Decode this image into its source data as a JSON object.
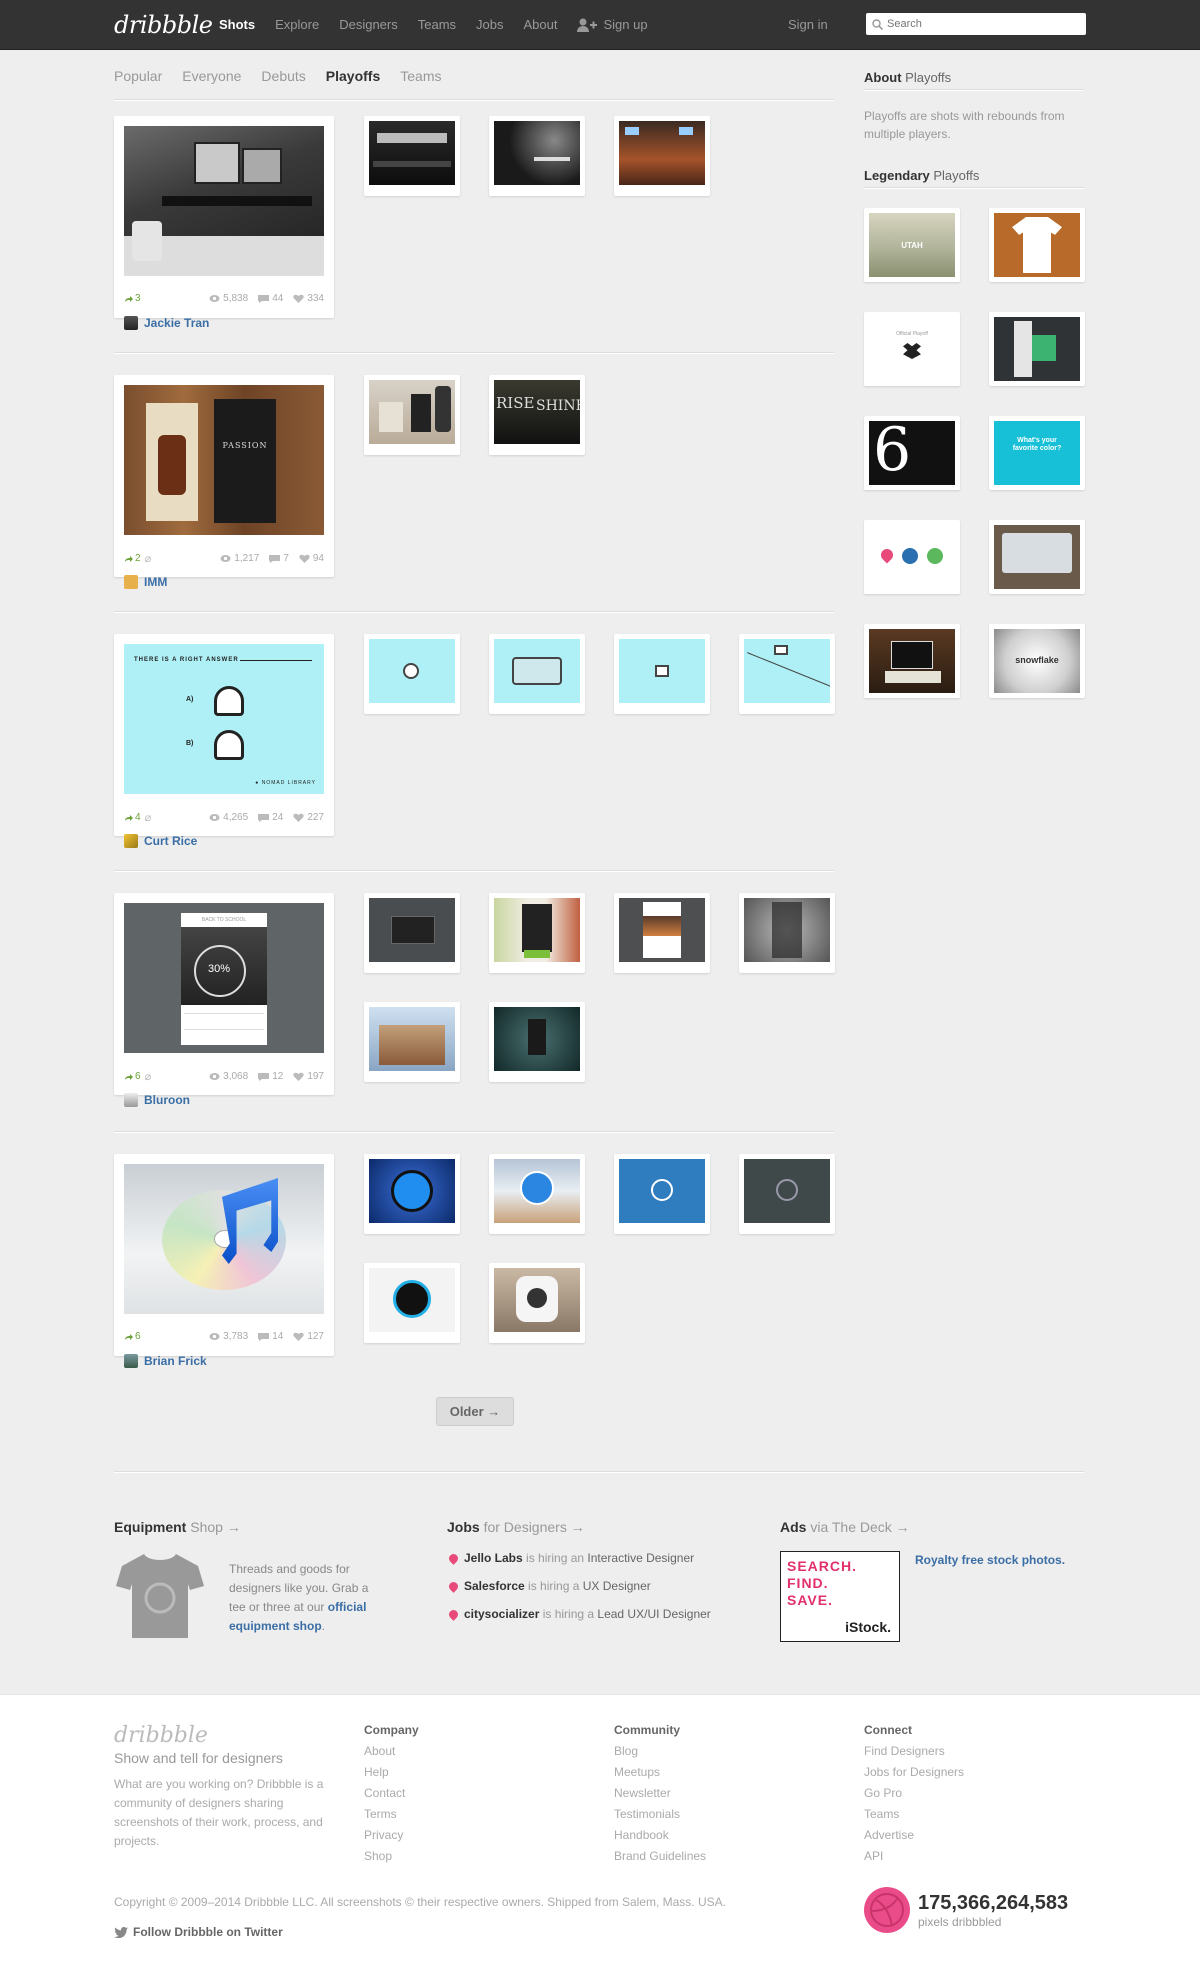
{
  "topbar": {
    "logo": "dribbble",
    "nav": [
      "Shots",
      "Explore",
      "Designers",
      "Teams",
      "Jobs",
      "About"
    ],
    "signup": "Sign up",
    "signin": "Sign in",
    "search_placeholder": "Search"
  },
  "subnav": [
    "Popular",
    "Everyone",
    "Debuts",
    "Playoffs",
    "Teams"
  ],
  "playoffs": [
    {
      "rebounds": "3",
      "views": "5,838",
      "comments": "44",
      "likes": "334",
      "author": "Jackie Tran",
      "attachment": false
    },
    {
      "rebounds": "2",
      "views": "1,217",
      "comments": "7",
      "likes": "94",
      "author": "IMM",
      "attachment": true
    },
    {
      "rebounds": "4",
      "views": "4,265",
      "comments": "24",
      "likes": "227",
      "author": "Curt Rice",
      "attachment": true
    },
    {
      "rebounds": "6",
      "views": "3,068",
      "comments": "12",
      "likes": "197",
      "author": "Bluroon",
      "attachment": true
    },
    {
      "rebounds": "6",
      "views": "3,783",
      "comments": "14",
      "likes": "127",
      "author": "Brian Frick",
      "attachment": false
    }
  ],
  "shot_texts": {
    "right_answer": "THERE IS A RIGHT ANSWER",
    "a": "A)",
    "b": "B)",
    "brand": "● NOMAD LIBRARY",
    "percent": "30%",
    "back_to_school": "BACK TO SCHOOL",
    "rise": "RISE",
    "shine": "SHINE",
    "passion": "PASSION"
  },
  "older": "Older →",
  "sidebar": {
    "about_bold": "About",
    "about_rest": " Playoffs",
    "about_text": "Playoffs are shots with rebounds from multiple players.",
    "legendary_bold": "Legendary",
    "legendary_rest": " Playoffs",
    "utah": "UTAH",
    "official_playoff": "Official Playoff",
    "six": "6",
    "fav_color": "What's your favorite color?",
    "snowflake": "snowflake"
  },
  "bottom": {
    "equipment_bold": "Equipment",
    "equipment_rest": " Shop →",
    "equipment_text_1": "Threads and goods for designers like you. Grab a tee or three at our ",
    "equipment_link": "official equipment shop",
    "equipment_text_2": ".",
    "jobs_bold": "Jobs",
    "jobs_rest": " for Designers →",
    "jobs": [
      {
        "company": "Jello Labs",
        "mid": " is hiring an ",
        "role": "Interactive Designer"
      },
      {
        "company": "Salesforce",
        "mid": " is hiring a ",
        "role": "UX Designer"
      },
      {
        "company": "citysocializer",
        "mid": " is hiring a ",
        "role": "Lead UX/UI Designer"
      }
    ],
    "ads_bold": "Ads",
    "ads_rest": " via The Deck →",
    "ad_line1": "SEARCH.",
    "ad_line2": "FIND.",
    "ad_line3": "SAVE.",
    "ad_brand": "iStock.",
    "ad_link": "Royalty free stock photos."
  },
  "footer": {
    "logo": "dribbble",
    "tagline": "Show and tell for designers",
    "desc": "What are you working on? Dribbble is a community of designers sharing screenshots of their work, process, and projects.",
    "columns": [
      {
        "title": "Company",
        "links": [
          "About",
          "Help",
          "Contact",
          "Terms",
          "Privacy",
          "Shop"
        ]
      },
      {
        "title": "Community",
        "links": [
          "Blog",
          "Meetups",
          "Newsletter",
          "Testimonials",
          "Handbook",
          "Brand Guidelines"
        ]
      },
      {
        "title": "Connect",
        "links": [
          "Find Designers",
          "Jobs for Designers",
          "Go Pro",
          "Teams",
          "Advertise",
          "API"
        ]
      }
    ],
    "copyright": "Copyright © 2009–2014 Dribbble LLC. All screenshots © their respective owners. Shipped from Salem, Mass. USA.",
    "twitter": "Follow Dribbble on Twitter",
    "count": "175,366,264,583",
    "count_label": "pixels dribbbled"
  },
  "colors": {
    "link": "#3a6ea5",
    "pink": "#ea4c89",
    "green": "#6ba33a",
    "topbar": "#333333"
  }
}
